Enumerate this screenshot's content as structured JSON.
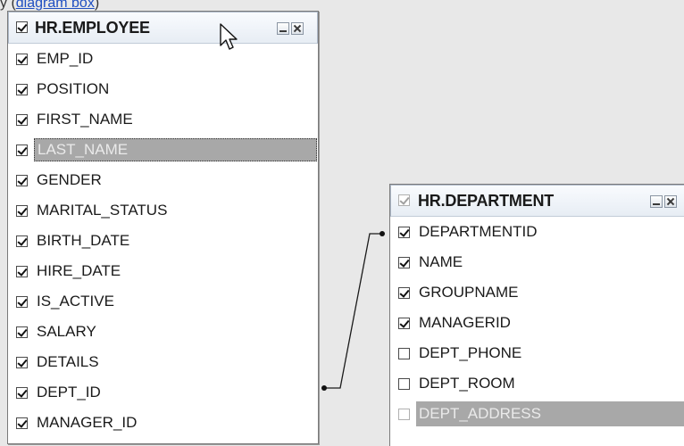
{
  "page": {
    "top_fragment_prefix": "y  (",
    "top_fragment_link": "diagram box",
    "top_fragment_suffix": ")"
  },
  "employee_table": {
    "title": "HR.EMPLOYEE",
    "title_checked": true,
    "fields": [
      {
        "name": "EMP_ID",
        "checked": true,
        "state": "normal"
      },
      {
        "name": "POSITION",
        "checked": true,
        "state": "normal"
      },
      {
        "name": "FIRST_NAME",
        "checked": true,
        "state": "normal"
      },
      {
        "name": "LAST_NAME",
        "checked": true,
        "state": "selected"
      },
      {
        "name": "GENDER",
        "checked": true,
        "state": "normal"
      },
      {
        "name": "MARITAL_STATUS",
        "checked": true,
        "state": "normal"
      },
      {
        "name": "BIRTH_DATE",
        "checked": true,
        "state": "normal"
      },
      {
        "name": "HIRE_DATE",
        "checked": true,
        "state": "normal"
      },
      {
        "name": "IS_ACTIVE",
        "checked": true,
        "state": "normal"
      },
      {
        "name": "SALARY",
        "checked": true,
        "state": "normal"
      },
      {
        "name": "DETAILS",
        "checked": true,
        "state": "normal"
      },
      {
        "name": "DEPT_ID",
        "checked": true,
        "state": "normal"
      },
      {
        "name": "MANAGER_ID",
        "checked": true,
        "state": "normal"
      }
    ]
  },
  "department_table": {
    "title": "HR.DEPARTMENT",
    "title_checked": true,
    "fields": [
      {
        "name": "DEPARTMENTID",
        "checked": true,
        "state": "normal"
      },
      {
        "name": "NAME",
        "checked": true,
        "state": "normal"
      },
      {
        "name": "GROUPNAME",
        "checked": true,
        "state": "normal"
      },
      {
        "name": "MANAGERID",
        "checked": true,
        "state": "normal"
      },
      {
        "name": "DEPT_PHONE",
        "checked": false,
        "state": "normal"
      },
      {
        "name": "DEPT_ROOM",
        "checked": false,
        "state": "normal"
      },
      {
        "name": "DEPT_ADDRESS",
        "checked": false,
        "state": "disabled"
      }
    ]
  },
  "relationship": {
    "from": "HR.EMPLOYEE.DEPT_ID",
    "to": "HR.DEPARTMENT.DEPARTMENTID"
  },
  "colors": {
    "canvas": "#e8e8e8",
    "panel_border": "#7a7a7a",
    "selected_row_bg": "#a8a8a8",
    "link": "#1f4fc2"
  }
}
